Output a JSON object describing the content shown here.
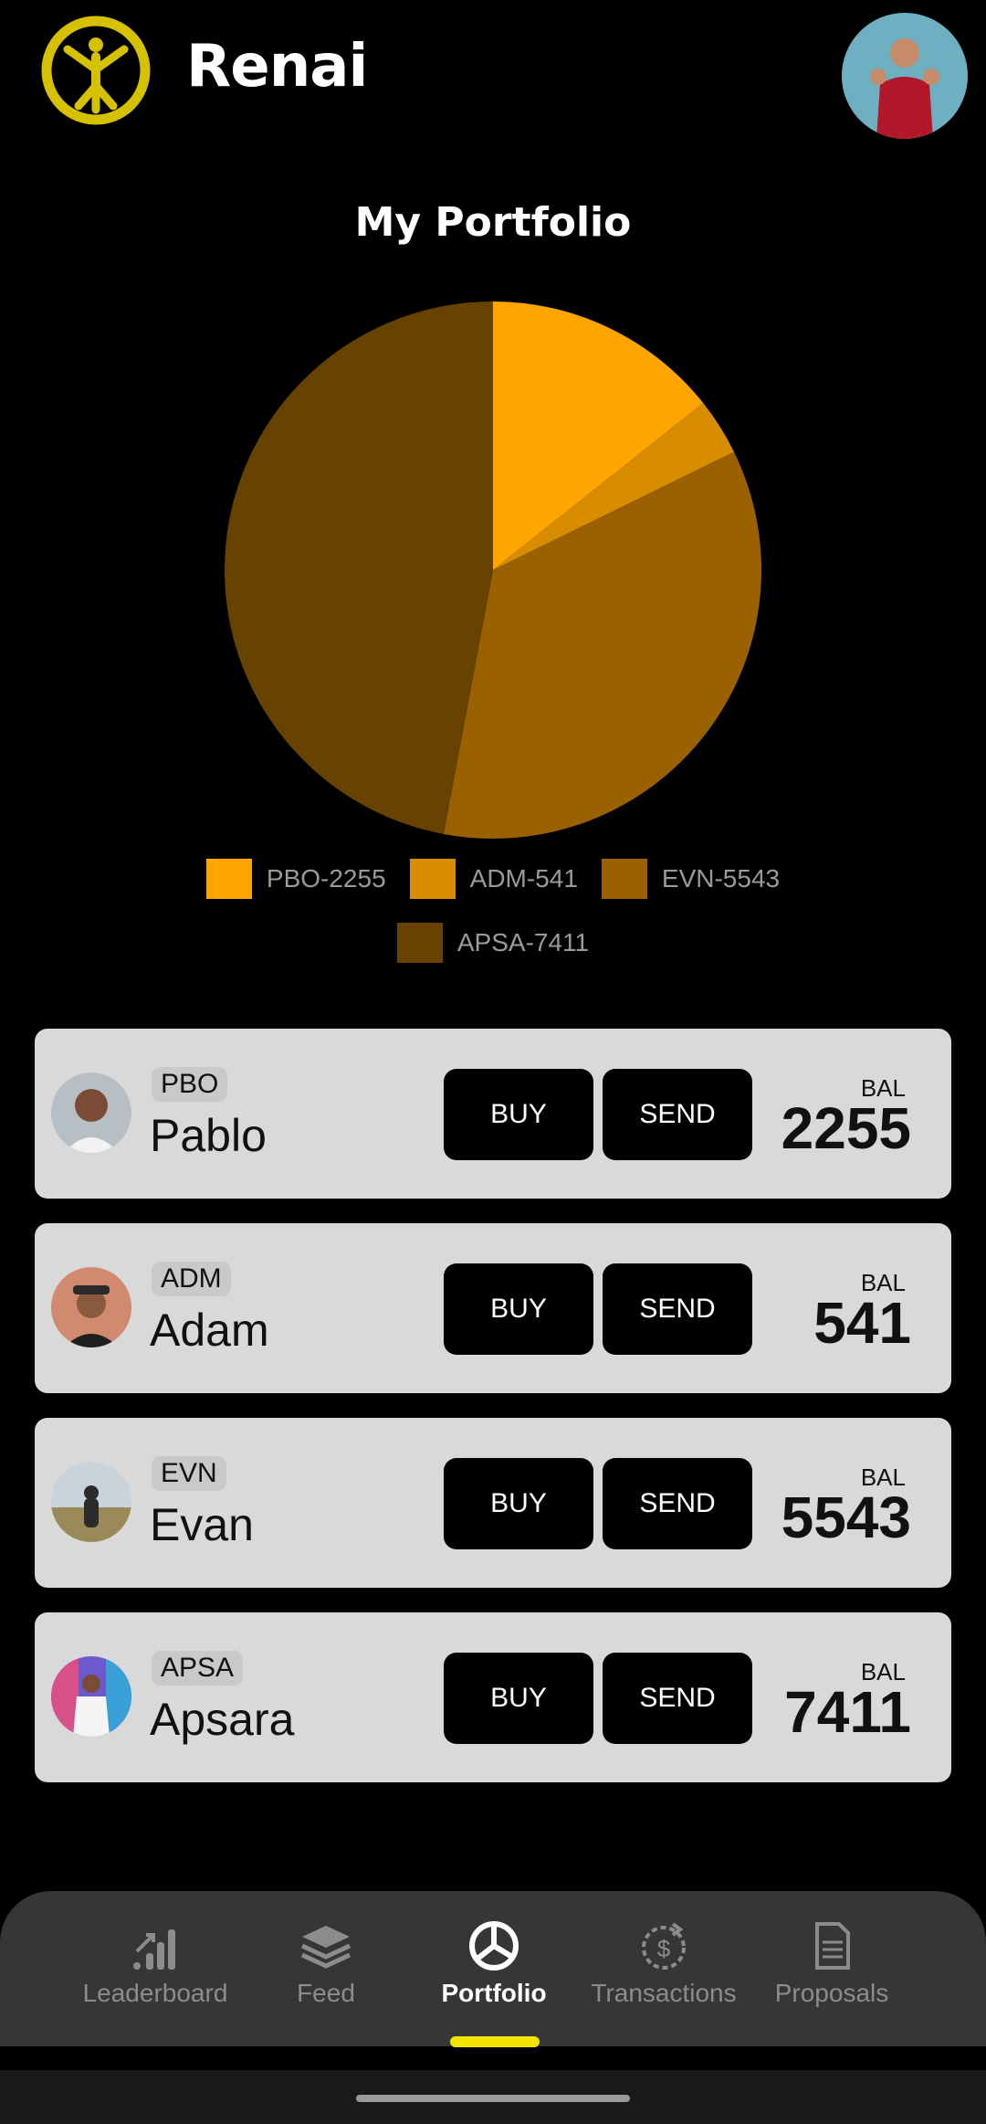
{
  "app": {
    "title": "Renai"
  },
  "colors": {
    "brand_yellow": "#d6c100",
    "card_bg": "#d9d9d9",
    "pbo": "#ffa500",
    "adm": "#d88c00",
    "evn": "#9a6100",
    "apsa": "#674200",
    "nav_indicator": "#f2e600"
  },
  "portfolio": {
    "title": "My Portfolio"
  },
  "chart_data": {
    "type": "pie",
    "labels": [
      "PBO-2255",
      "ADM-541",
      "EVN-5543",
      "APSA-7411"
    ],
    "values": [
      2255,
      541,
      5543,
      7411
    ],
    "colors": [
      "#ffa500",
      "#d88c00",
      "#9a6100",
      "#674200"
    ],
    "legend_position": "bottom"
  },
  "holdings": [
    {
      "ticker": "PBO",
      "name": "Pablo",
      "buy_label": "BUY",
      "send_label": "SEND",
      "bal_label": "BAL",
      "balance": "2255"
    },
    {
      "ticker": "ADM",
      "name": "Adam",
      "buy_label": "BUY",
      "send_label": "SEND",
      "bal_label": "BAL",
      "balance": "541"
    },
    {
      "ticker": "EVN",
      "name": "Evan",
      "buy_label": "BUY",
      "send_label": "SEND",
      "bal_label": "BAL",
      "balance": "5543"
    },
    {
      "ticker": "APSA",
      "name": "Apsara",
      "buy_label": "BUY",
      "send_label": "SEND",
      "bal_label": "BAL",
      "balance": "7411"
    }
  ],
  "nav": {
    "items": [
      {
        "label": "Leaderboard",
        "icon": "leaderboard-icon"
      },
      {
        "label": "Feed",
        "icon": "layers-icon"
      },
      {
        "label": "Portfolio",
        "icon": "portfolio-icon",
        "active": true
      },
      {
        "label": "Transactions",
        "icon": "transactions-icon"
      },
      {
        "label": "Proposals",
        "icon": "document-icon"
      }
    ]
  }
}
